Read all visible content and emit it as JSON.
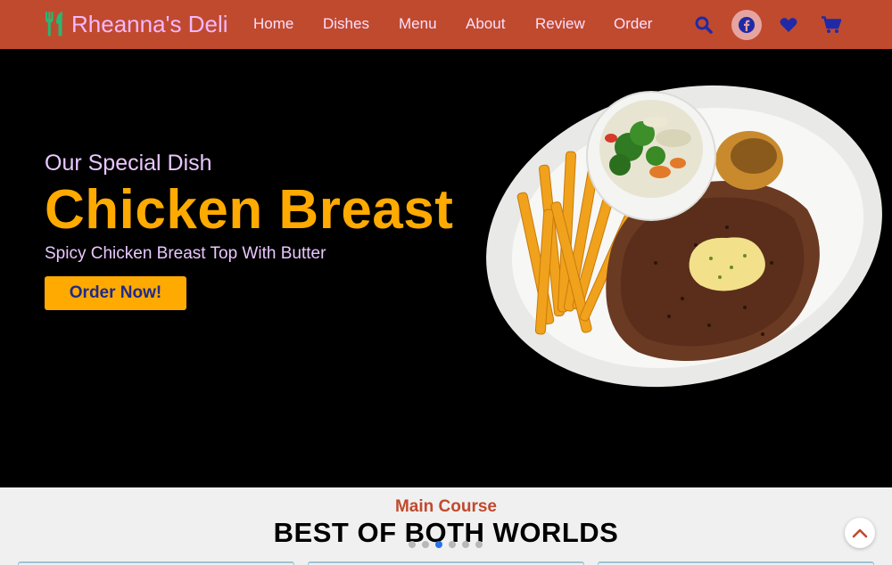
{
  "brand": {
    "name": "Rheanna's Deli",
    "icon": "utensils-icon",
    "icon_color": "#2bb673"
  },
  "colors": {
    "header_bg": "#c04a2e",
    "accent": "#ffaa00",
    "nav_text": "#fbe0ff",
    "icon_blue": "#1f2aa8"
  },
  "nav": {
    "items": [
      {
        "label": "Home"
      },
      {
        "label": "Dishes"
      },
      {
        "label": "Menu"
      },
      {
        "label": "About"
      },
      {
        "label": "Review"
      },
      {
        "label": "Order"
      }
    ]
  },
  "header_icons": [
    "search-icon",
    "facebook-icon",
    "heart-icon",
    "cart-icon"
  ],
  "hero": {
    "subtitle": "Our Special Dish",
    "title": "Chicken Breast",
    "description": "Spicy Chicken Breast Top With Butter",
    "button": "Order Now!",
    "image": "plate-steak-fries-salad"
  },
  "section": {
    "label": "Main Course",
    "title": "BEST OF BOTH WORLDS"
  },
  "carousel": {
    "total": 6,
    "active_index": 2
  },
  "scroll_top_icon": "chevron-up-icon"
}
